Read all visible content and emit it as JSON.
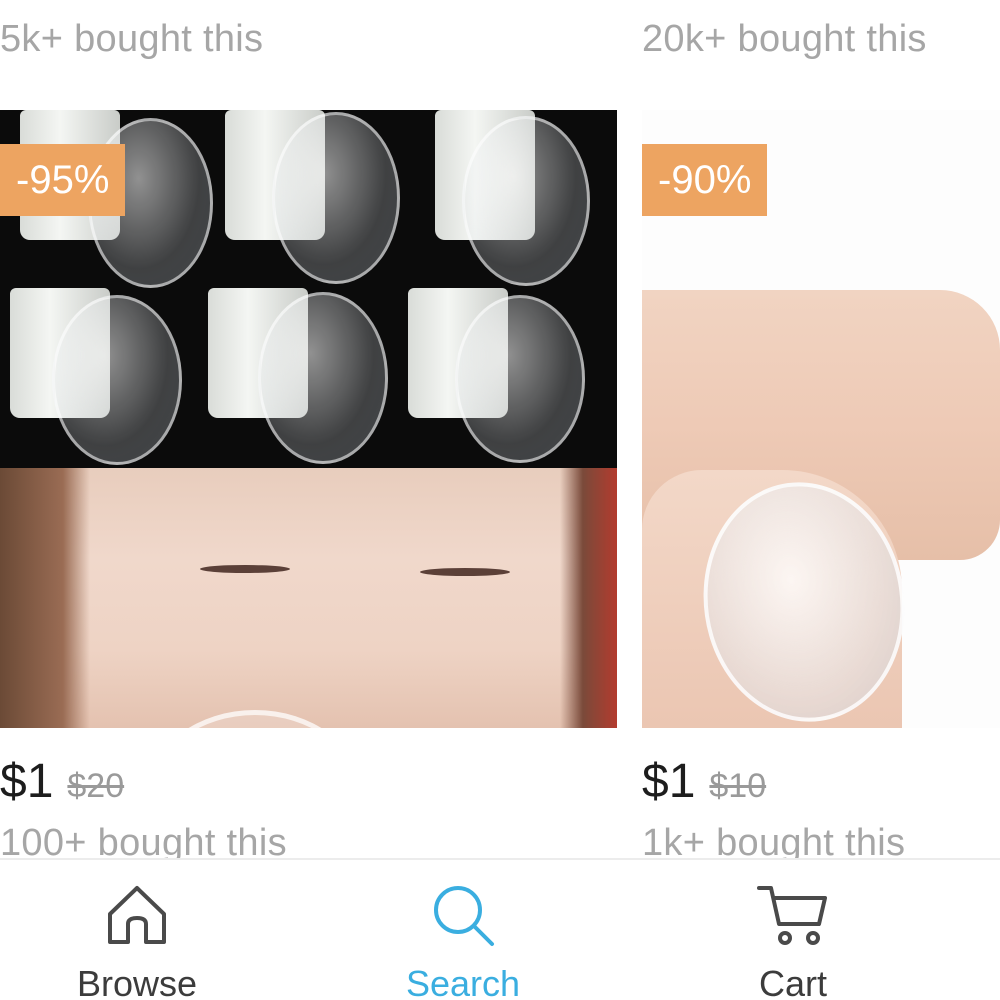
{
  "products": [
    {
      "top_sold": "5k+ bought this",
      "discount": "-95%",
      "price": "$1",
      "original_price": "$20",
      "sold": "100+ bought this"
    },
    {
      "top_sold": "20k+ bought this",
      "discount": "-90%",
      "price": "$1",
      "original_price": "$10",
      "sold": "1k+ bought this"
    }
  ],
  "nav": {
    "browse": {
      "label": "Browse",
      "icon": "home-icon"
    },
    "search": {
      "label": "Search",
      "icon": "search-icon",
      "active": true
    },
    "cart": {
      "label": "Cart",
      "icon": "cart-icon"
    }
  },
  "colors": {
    "discount_badge": "#eda461",
    "active_tab": "#3aaee0",
    "muted_text": "#a6a6a6"
  }
}
